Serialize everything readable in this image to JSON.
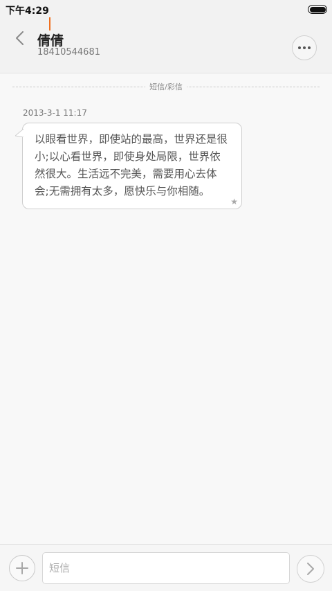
{
  "status_bar": {
    "time": "下午4:29",
    "battery_icon": "battery-full-icon"
  },
  "header": {
    "back_icon": "chevron-left-icon",
    "contact_name": "倩倩",
    "contact_number": "18410544681",
    "more_icon": "more-dots-icon"
  },
  "thread": {
    "divider_label": "短信/彩信",
    "messages": [
      {
        "timestamp": "2013-3-1 11:17",
        "text": "以眼看世界，即使站的最高，世界还是很小;以心看世界，即使身处局限，世界依然很大。生活远不完美，需要用心去体会;无需拥有太多，愿快乐与你相随。",
        "star_icon": "star-icon"
      }
    ]
  },
  "composer": {
    "add_icon": "plus-icon",
    "input_value": "",
    "input_placeholder": "短信",
    "send_icon": "chevron-right-icon"
  },
  "colors": {
    "caret": "#f07020",
    "header_bg": "#f2f2f2",
    "page_bg": "#f8f8f8"
  }
}
